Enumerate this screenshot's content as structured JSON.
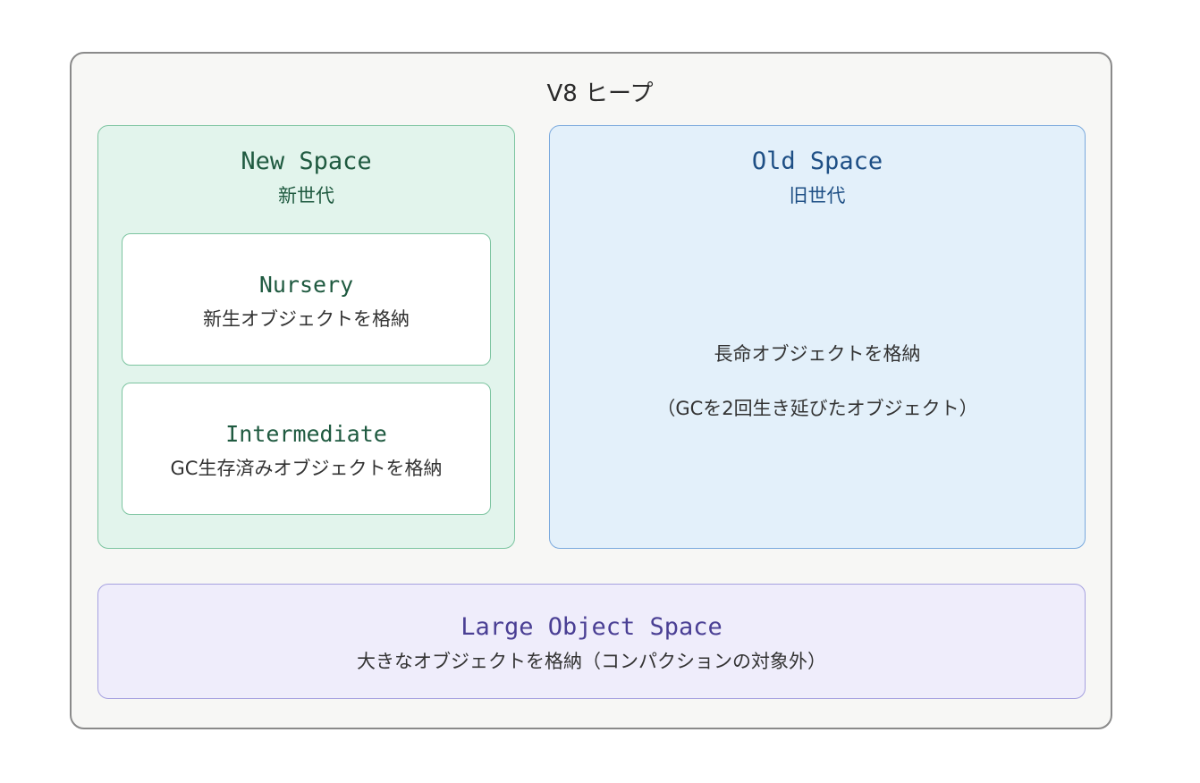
{
  "heap": {
    "title": "V8 ヒープ"
  },
  "new_space": {
    "title": "New Space",
    "subtitle": "新世代",
    "nursery": {
      "title": "Nursery",
      "description": "新生オブジェクトを格納"
    },
    "intermediate": {
      "title": "Intermediate",
      "description": "GC生存済みオブジェクトを格納"
    }
  },
  "old_space": {
    "title": "Old Space",
    "subtitle": "旧世代",
    "description_line1": "長命オブジェクトを格納",
    "description_line2": "（GCを2回生き延びたオブジェクト）"
  },
  "large_object_space": {
    "title": "Large Object Space",
    "description": "大きなオブジェクトを格納（コンパクションの対象外）"
  },
  "colors": {
    "new_space_fill": "#e2f4ec",
    "new_space_stroke": "#7cc4a0",
    "old_space_fill": "#e3f0fa",
    "old_space_stroke": "#7aa9dd",
    "large_object_fill": "#efedfb",
    "large_object_stroke": "#a6a1e0",
    "heap_fill": "#f7f7f5",
    "heap_stroke": "#8a8a8a"
  }
}
